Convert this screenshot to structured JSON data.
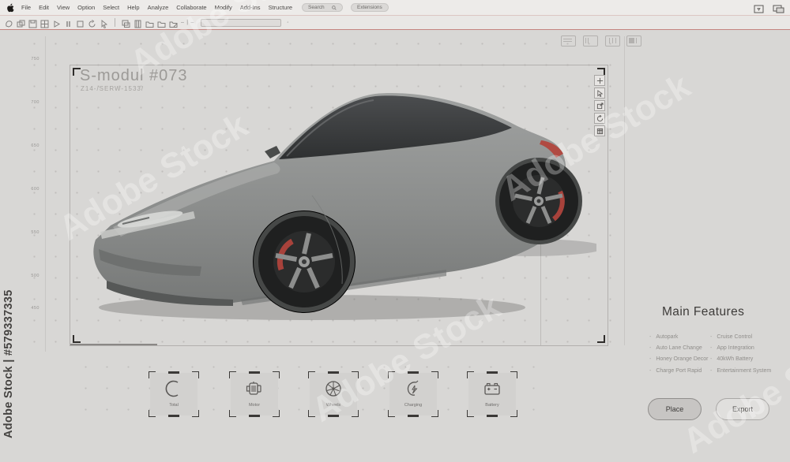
{
  "menu_bar": {
    "apple_icon": "apple-logo",
    "items": [
      "File",
      "Edit",
      "View",
      "Option",
      "Select",
      "Help",
      "Analyze",
      "Collaborate",
      "Modify",
      "Add-Ins",
      "Structure"
    ],
    "search_label": "Search",
    "extensions_label": "Extensions"
  },
  "viewport": {
    "title": "S-modul #073",
    "subtitle": "Z14-/SERW-1533/",
    "ruler_labels": [
      "750",
      "700",
      "650",
      "600",
      "550",
      "500",
      "450"
    ],
    "tool_icons": [
      "move-icon",
      "select-cursor-icon",
      "export-box-icon",
      "rotate-icon",
      "grid-icon"
    ],
    "layout_icons": [
      "view-layout-1",
      "view-layout-2",
      "view-layout-3",
      "view-layout-4"
    ]
  },
  "features": {
    "heading": "Main Features",
    "left": [
      "Autopark",
      "Auto Lane Change",
      "Honey Orange Decor",
      "Charge Port Rapid"
    ],
    "right": [
      "Cruise Control",
      "App Integration",
      "40kWh Battery",
      "Entertainment System"
    ]
  },
  "actions": {
    "place_label": "Place",
    "export_label": "Export"
  },
  "categories": [
    {
      "label": "Total",
      "icon": "crescent-icon"
    },
    {
      "label": "Motor",
      "icon": "motor-icon"
    },
    {
      "label": "Wheels",
      "icon": "wheel-icon"
    },
    {
      "label": "Charging",
      "icon": "charging-icon"
    },
    {
      "label": "Battery",
      "icon": "battery-icon"
    }
  ],
  "watermark": {
    "vertical_text": "Adobe Stock | #579337335",
    "tile_text": "Adobe Stock"
  },
  "colors": {
    "accent_red": "#a8423b",
    "canvas_bg": "#d8d7d5",
    "text_dark": "#3e3c3a",
    "text_gray": "#908e8b"
  }
}
